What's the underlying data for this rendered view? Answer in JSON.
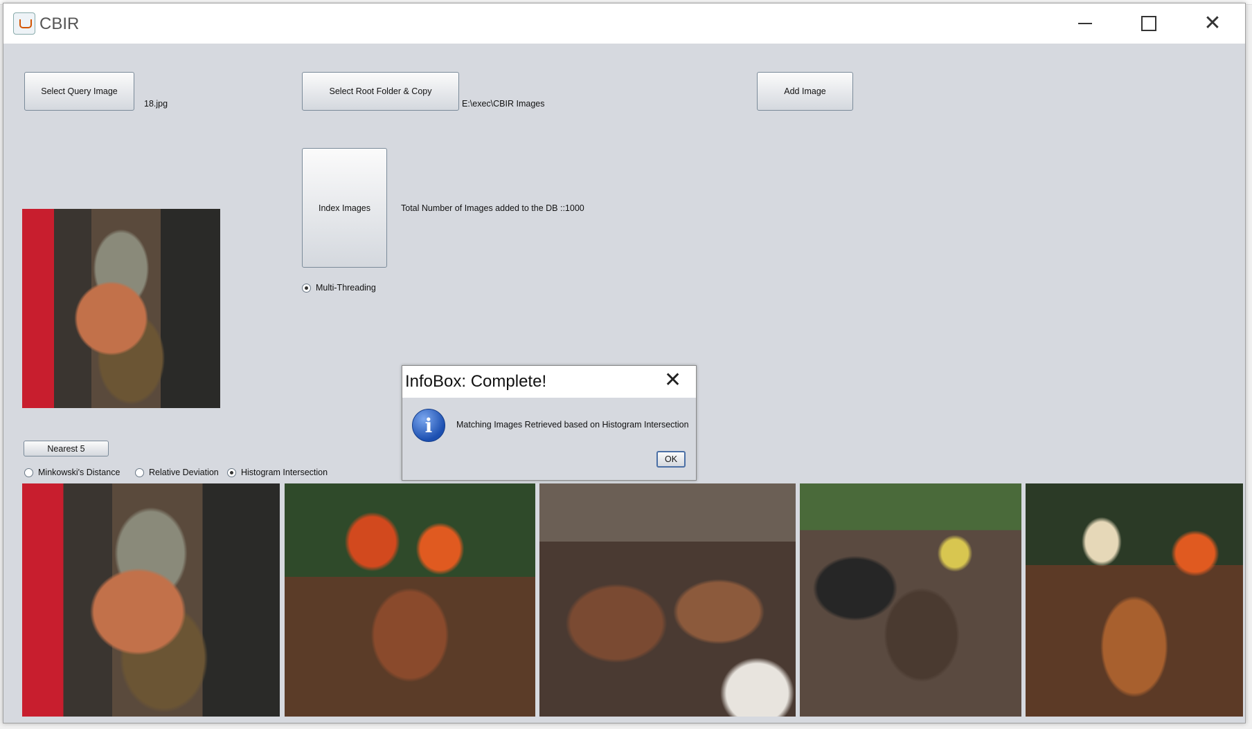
{
  "window": {
    "title": "CBIR"
  },
  "controls": {
    "select_query_label": "Select Query Image",
    "query_filename": "18.jpg",
    "select_root_label": "Select Root Folder & Copy",
    "root_path": "E:\\exec\\CBIR Images",
    "add_image_label": "Add Image",
    "index_images_label": "Index Images",
    "index_status": "Total Number of Images added to the DB ::1000",
    "multithreading_label": "Multi-Threading",
    "nearest_label": "Nearest 5"
  },
  "distance_options": [
    {
      "label": "Minkowski's Distance",
      "selected": false
    },
    {
      "label": "Relative Deviation",
      "selected": false
    },
    {
      "label": "Histogram Intersection",
      "selected": true
    }
  ],
  "results": {
    "count": 5
  },
  "dialog": {
    "title": "InfoBox: Complete!",
    "message": "Matching Images Retrieved based on Histogram Intersection",
    "ok_label": "OK",
    "icon": "info-icon"
  }
}
